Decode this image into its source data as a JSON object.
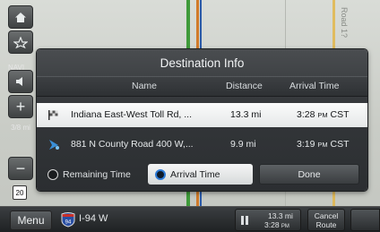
{
  "map": {
    "road_label": "Road 1?",
    "colors": {
      "road_green": "#3f9a3a",
      "road_orange": "#d07a2a",
      "road_blue": "#2b5aa8",
      "road_yellow": "#e2b64a"
    }
  },
  "side_controls": {
    "home_icon": "home-icon",
    "destination_icon": "destination-icon",
    "navi_label": "NAVI",
    "volume_icon": "speaker-icon",
    "zoom_in_icon": "plus-icon",
    "scale_label": "3/8 mi",
    "zoom_out_icon": "minus-icon",
    "shield_label": "20"
  },
  "dialog": {
    "title": "Destination Info",
    "columns": {
      "name": "Name",
      "distance": "Distance",
      "arrival": "Arrival Time"
    },
    "rows": [
      {
        "icon": "flag-icon",
        "name": "Indiana East-West Toll Rd, ...",
        "distance": "13.3 mi",
        "arrival_time": "3:28",
        "arrival_ampm": "PM",
        "arrival_tz": "CST",
        "selected": true
      },
      {
        "icon": "waypoint-icon",
        "name": "881 N County Road 400 W,...",
        "distance": "9.9 mi",
        "arrival_time": "3:19",
        "arrival_ampm": "PM",
        "arrival_tz": "CST",
        "selected": false
      }
    ],
    "options": {
      "remaining_time": "Remaining Time",
      "arrival_time": "Arrival Time",
      "selected": "arrival_time"
    },
    "done_label": "Done"
  },
  "bottom_bar": {
    "menu_label": "Menu",
    "current_road": "I-94 W",
    "interstate_number": "94",
    "eta_distance": "13.3 mi",
    "eta_time": "3:28",
    "eta_ampm": "PM",
    "cancel_route_line1": "Cancel",
    "cancel_route_line2": "Route"
  }
}
